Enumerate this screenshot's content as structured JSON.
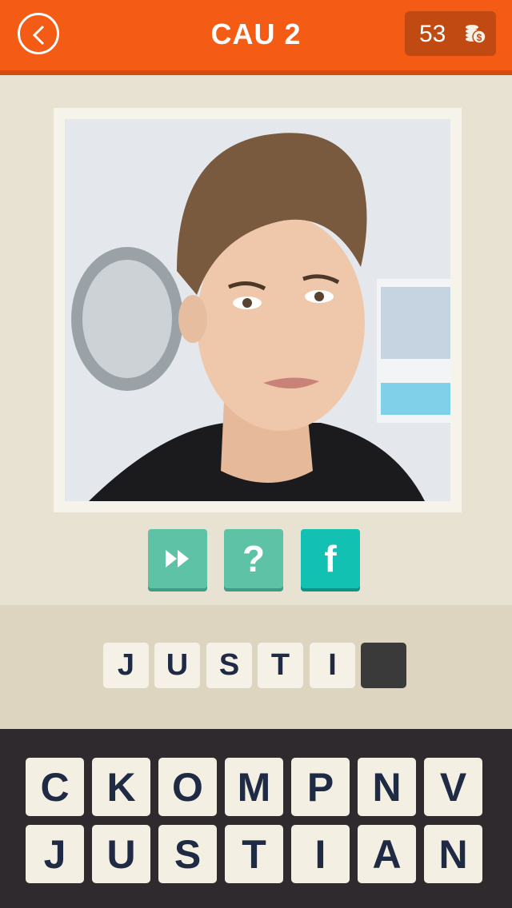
{
  "header": {
    "title": "CAU 2",
    "coins": "53"
  },
  "actions": {
    "skip_icon": "fast-forward-icon",
    "hint_label": "?",
    "facebook_label": "f"
  },
  "answer": {
    "letters": [
      "J",
      "U",
      "S",
      "T",
      "I",
      ""
    ]
  },
  "keyboard": {
    "row1": [
      "C",
      "K",
      "O",
      "M",
      "P",
      "N",
      "V"
    ],
    "row2": [
      "J",
      "U",
      "S",
      "T",
      "I",
      "A",
      "N"
    ]
  },
  "colors": {
    "header": "#f45c16",
    "teal": "#5ec2a6",
    "facebook_teal": "#12c1b1",
    "keyboard_bg": "#2f2a2e"
  }
}
